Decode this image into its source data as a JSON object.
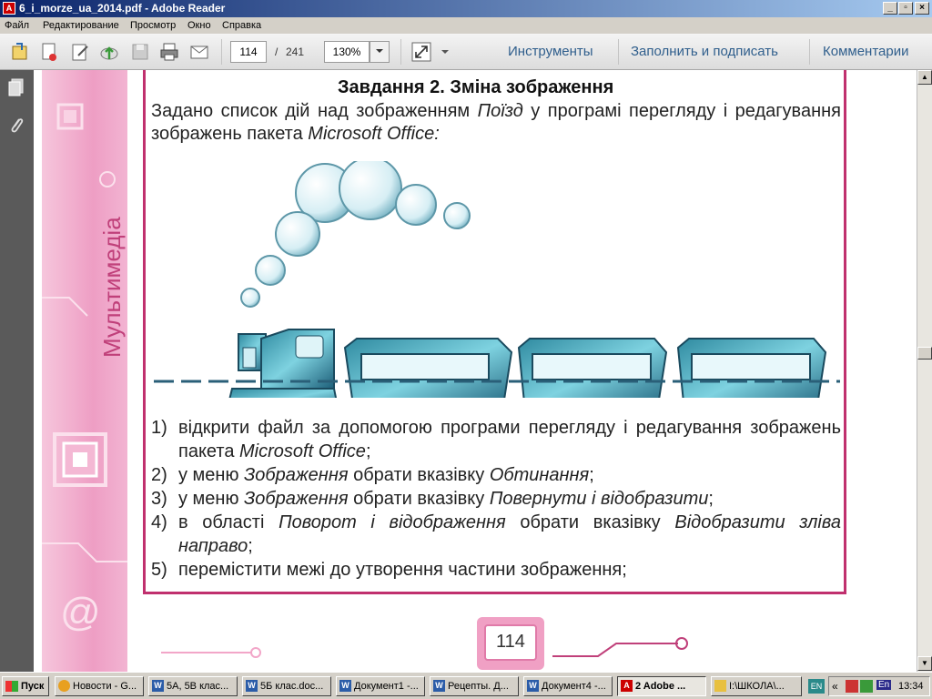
{
  "window": {
    "title": "6_i_morze_ua_2014.pdf - Adobe Reader",
    "buttons": {
      "minimize": "_",
      "maximize": "▫",
      "close": "×"
    }
  },
  "menu": [
    "Файл",
    "Редактирование",
    "Просмотр",
    "Окно",
    "Справка"
  ],
  "toolbar": {
    "page_current": "114",
    "page_separator": "/",
    "page_total": "241",
    "zoom": "130%",
    "tools_label": "Инструменты",
    "fill_sign_label": "Заполнить и подписать",
    "comments_label": "Комментарии"
  },
  "document": {
    "side_title": "Мультимедіа",
    "task_title": "Завдання 2. Зміна зображення",
    "intro": {
      "t1": "Задано список дій над зображенням ",
      "i1": "Поїзд",
      "t2": " у програмі перегляду і редагування зображень пакета ",
      "i2": "Microsoft Office:"
    },
    "steps": [
      {
        "num": "1)",
        "a": "відкрити файл за допомогою програми перегляду і редагування зображень пакета ",
        "b": "Microsoft Office",
        "c": ";"
      },
      {
        "num": "2)",
        "a": "у меню ",
        "b": "Зображення",
        "c": " обрати вказівку ",
        "d": "Обтинання",
        "e": ";"
      },
      {
        "num": "3)",
        "a": "у меню ",
        "b": "Зображення",
        "c": " обрати вказівку ",
        "d": "Повернути і відобразити",
        "e": ";"
      },
      {
        "num": "4)",
        "a": "в області ",
        "b": "Поворот і відображення",
        "c": " обрати вказівку ",
        "d": "Відобразити зліва направо",
        "e": ";"
      },
      {
        "num": "5)",
        "a": "перемістити межі до утворення частини зображення;"
      }
    ],
    "page_number": "114"
  },
  "taskbar": {
    "start_label": "Пуск",
    "tasks": [
      "Новости - G...",
      "5А, 5В клас...",
      "5Б клас.doc...",
      "Документ1 -...",
      "Рецепты. Д...",
      "Документ4 -...",
      "2 Adobe ...",
      "I:\\ШКОЛА\\..."
    ],
    "lang": "EN",
    "lang2": "En",
    "clock": "13:34"
  },
  "colors": {
    "accent_pink": "#c0306e",
    "link_blue": "#2f5e8c",
    "nav_gray": "#5a5a5a"
  }
}
